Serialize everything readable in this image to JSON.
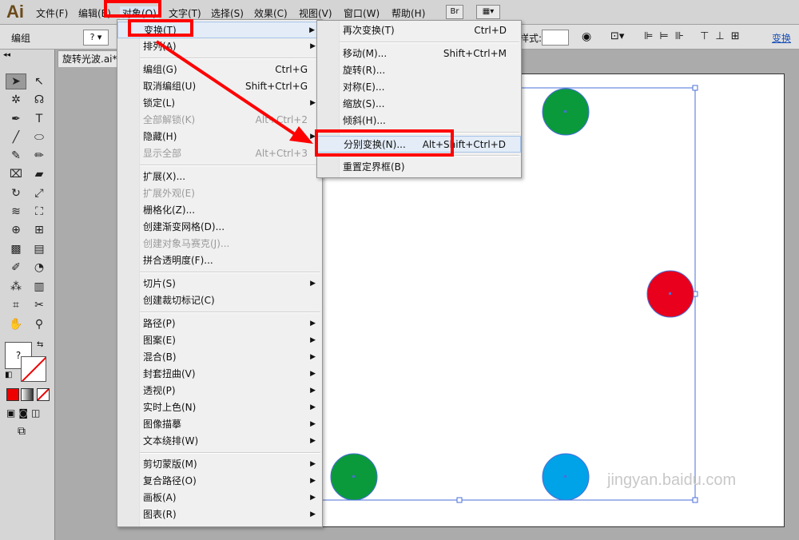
{
  "app": {
    "logo": "Ai"
  },
  "menubar": {
    "items": [
      "文件(F)",
      "编辑(E)",
      "对象(O)",
      "文字(T)",
      "选择(S)",
      "效果(C)",
      "视图(V)",
      "窗口(W)",
      "帮助(H)"
    ],
    "bridge_label": "Br"
  },
  "controlbar": {
    "selection_label": "编组",
    "style_label": "样式:",
    "transform_link": "变换"
  },
  "document": {
    "tab_title": "旋转光波.ai*"
  },
  "object_menu": {
    "items": [
      {
        "label": "变换(T)",
        "shortcut": "",
        "submenu": true
      },
      {
        "label": "排列(A)",
        "shortcut": "",
        "submenu": true
      },
      {
        "label": "编组(G)",
        "shortcut": "Ctrl+G"
      },
      {
        "label": "取消编组(U)",
        "shortcut": "Shift+Ctrl+G"
      },
      {
        "label": "锁定(L)",
        "shortcut": "",
        "submenu": true
      },
      {
        "label": "全部解锁(K)",
        "shortcut": "Alt+Ctrl+2",
        "disabled": true
      },
      {
        "label": "隐藏(H)",
        "shortcut": "",
        "submenu": true
      },
      {
        "label": "显示全部",
        "shortcut": "Alt+Ctrl+3",
        "disabled": true
      },
      {
        "label": "扩展(X)...",
        "shortcut": ""
      },
      {
        "label": "扩展外观(E)",
        "shortcut": "",
        "disabled": true
      },
      {
        "label": "栅格化(Z)...",
        "shortcut": ""
      },
      {
        "label": "创建渐变网格(D)...",
        "shortcut": ""
      },
      {
        "label": "创建对象马赛克(J)...",
        "shortcut": "",
        "disabled": true
      },
      {
        "label": "拼合透明度(F)...",
        "shortcut": ""
      },
      {
        "label": "切片(S)",
        "shortcut": "",
        "submenu": true
      },
      {
        "label": "创建裁切标记(C)",
        "shortcut": ""
      },
      {
        "label": "路径(P)",
        "shortcut": "",
        "submenu": true
      },
      {
        "label": "图案(E)",
        "shortcut": "",
        "submenu": true
      },
      {
        "label": "混合(B)",
        "shortcut": "",
        "submenu": true
      },
      {
        "label": "封套扭曲(V)",
        "shortcut": "",
        "submenu": true
      },
      {
        "label": "透视(P)",
        "shortcut": "",
        "submenu": true
      },
      {
        "label": "实时上色(N)",
        "shortcut": "",
        "submenu": true
      },
      {
        "label": "图像描摹",
        "shortcut": "",
        "submenu": true
      },
      {
        "label": "文本绕排(W)",
        "shortcut": "",
        "submenu": true
      },
      {
        "label": "剪切蒙版(M)",
        "shortcut": "",
        "submenu": true
      },
      {
        "label": "复合路径(O)",
        "shortcut": "",
        "submenu": true
      },
      {
        "label": "画板(A)",
        "shortcut": "",
        "submenu": true
      },
      {
        "label": "图表(R)",
        "shortcut": "",
        "submenu": true
      }
    ]
  },
  "transform_submenu": {
    "items": [
      {
        "label": "再次变换(T)",
        "shortcut": "Ctrl+D"
      },
      {
        "label": "移动(M)...",
        "shortcut": "Shift+Ctrl+M"
      },
      {
        "label": "旋转(R)...",
        "shortcut": ""
      },
      {
        "label": "对称(E)...",
        "shortcut": ""
      },
      {
        "label": "缩放(S)...",
        "shortcut": ""
      },
      {
        "label": "倾斜(H)...",
        "shortcut": ""
      },
      {
        "label": "分别变换(N)...",
        "shortcut": "Alt+Shift+Ctrl+D"
      },
      {
        "label": "重置定界框(B)",
        "shortcut": ""
      }
    ]
  },
  "artwork": {
    "circle_colors": {
      "green": "#0a9a3c",
      "red": "#e8001c",
      "blue": "#00a2e8",
      "selection": "#4a6fd8"
    }
  },
  "watermark": {
    "text": "jingyan.baidu.com"
  },
  "colors": {
    "annotation_red": "#ff0000"
  }
}
